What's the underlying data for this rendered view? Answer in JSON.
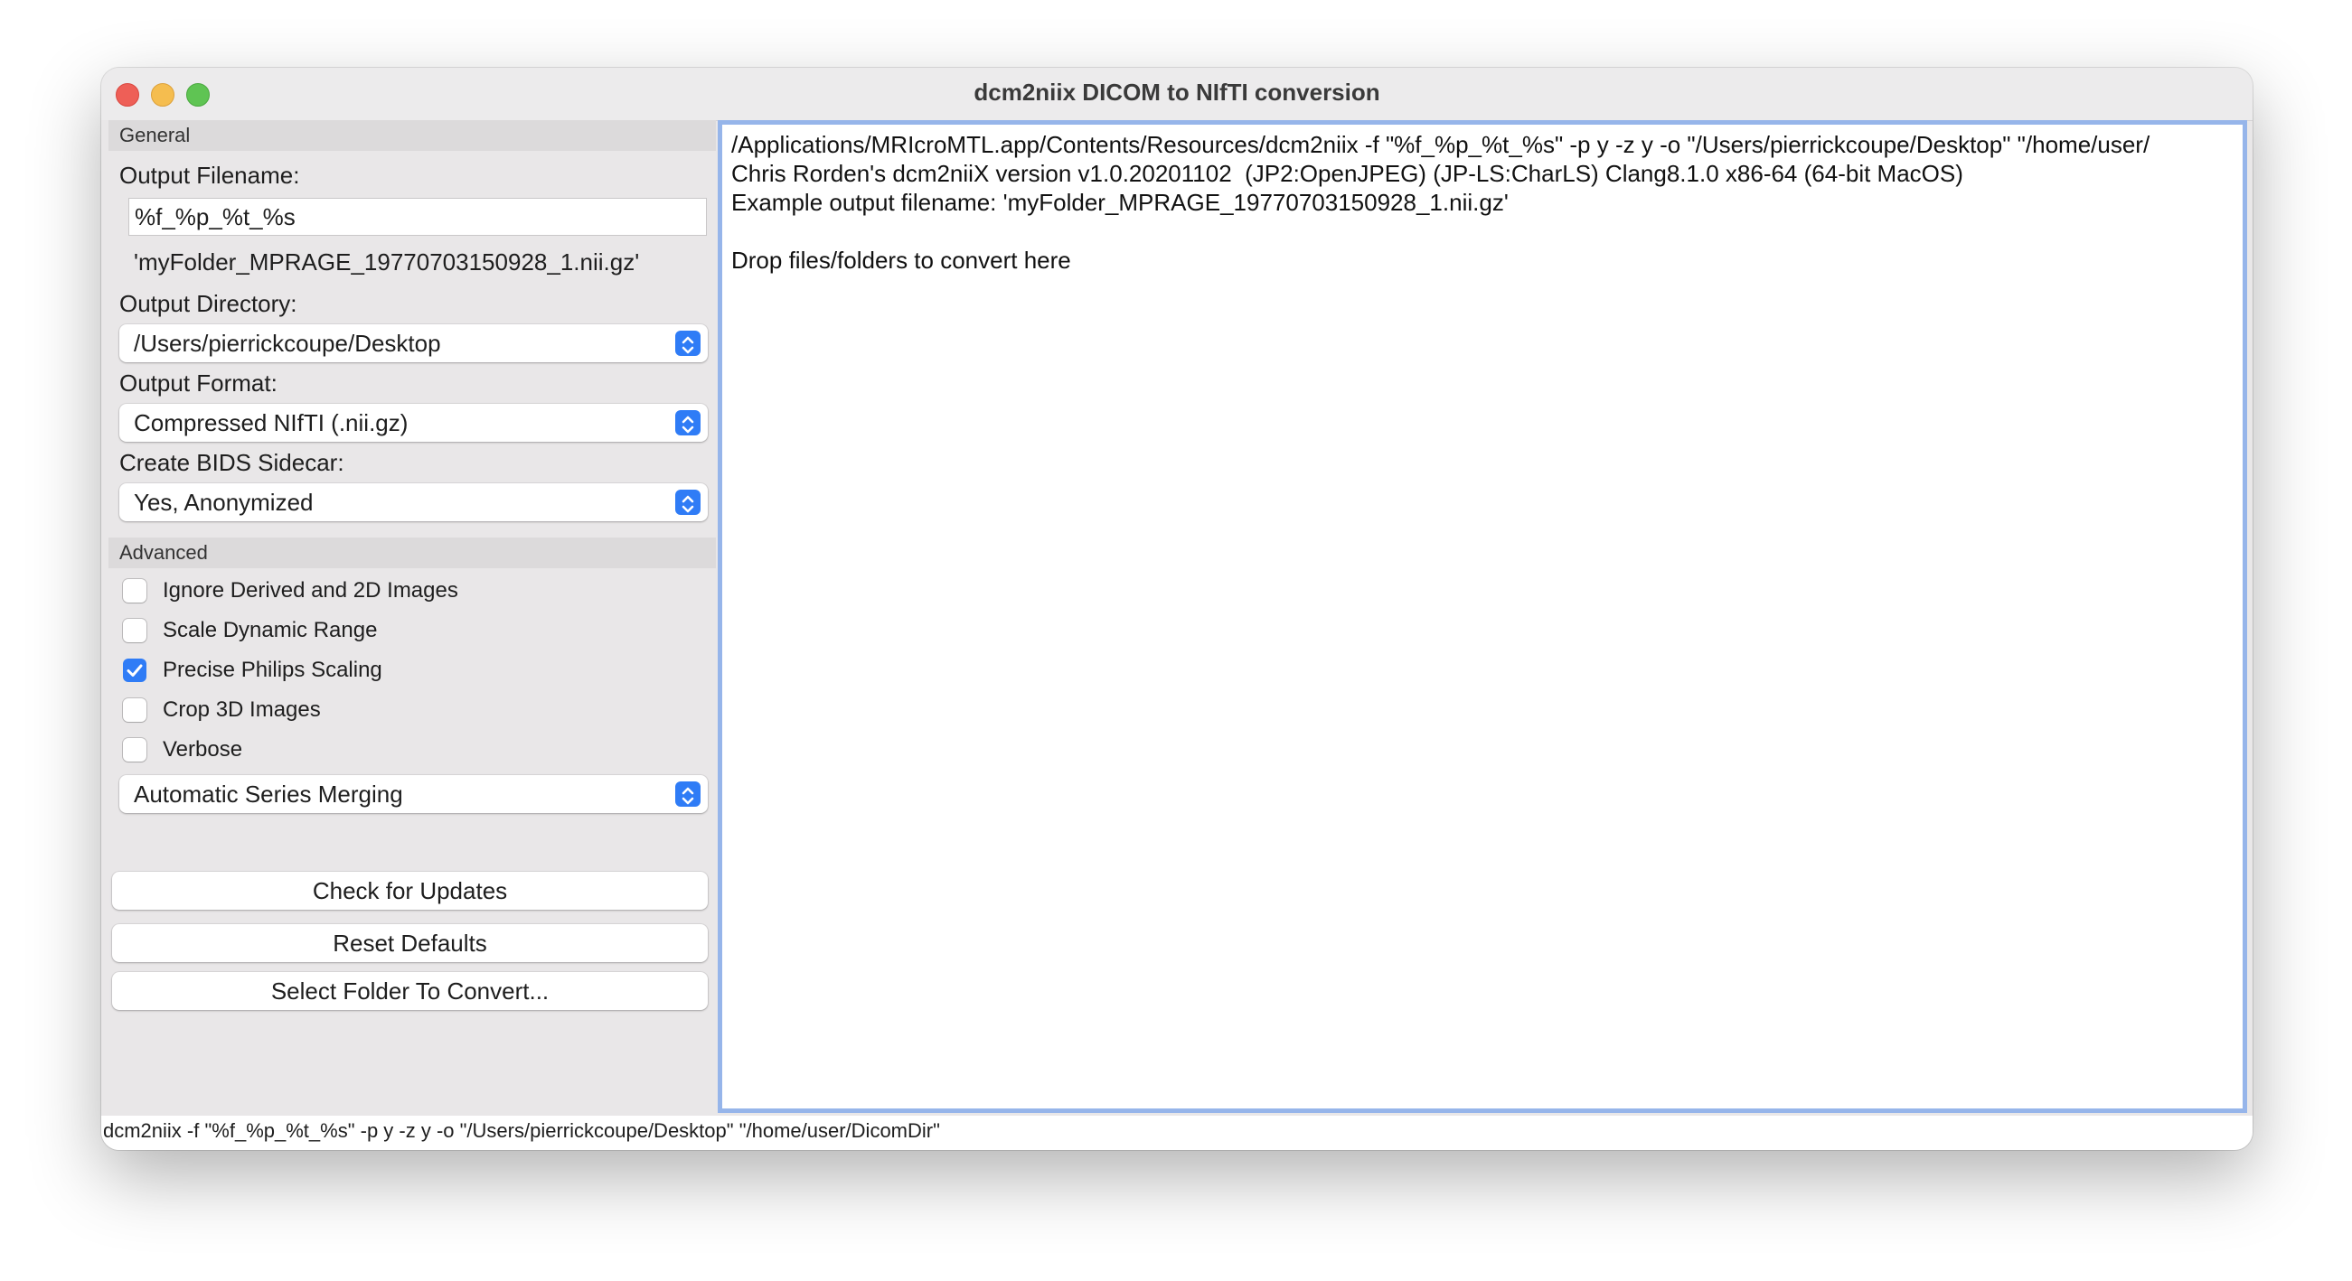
{
  "window": {
    "title": "dcm2niix DICOM to NIfTI conversion"
  },
  "general": {
    "header": "General",
    "output_filename_label": "Output Filename:",
    "output_filename_value": "%f_%p_%t_%s",
    "filename_example": "'myFolder_MPRAGE_19770703150928_1.nii.gz'",
    "output_directory_label": "Output Directory:",
    "output_directory_value": "/Users/pierrickcoupe/Desktop",
    "output_format_label": "Output Format:",
    "output_format_value": "Compressed NIfTI (.nii.gz)",
    "bids_label": "Create BIDS Sidecar:",
    "bids_value": "Yes, Anonymized"
  },
  "advanced": {
    "header": "Advanced",
    "options": [
      {
        "label": "Ignore Derived and 2D Images",
        "checked": false
      },
      {
        "label": "Scale Dynamic Range",
        "checked": false
      },
      {
        "label": "Precise Philips Scaling",
        "checked": true
      },
      {
        "label": "Crop 3D Images",
        "checked": false
      },
      {
        "label": "Verbose",
        "checked": false
      }
    ],
    "merge_value": "Automatic Series Merging"
  },
  "buttons": {
    "check_updates": "Check for Updates",
    "reset_defaults": "Reset Defaults",
    "select_folder": "Select Folder To Convert..."
  },
  "output": {
    "line1": "/Applications/MRIcroMTL.app/Contents/Resources/dcm2niix -f \"%f_%p_%t_%s\" -p y -z y -o \"/Users/pierrickcoupe/Desktop\" \"/home/user/",
    "line2": "Chris Rorden's dcm2niiX version v1.0.20201102  (JP2:OpenJPEG) (JP-LS:CharLS) Clang8.1.0 x86-64 (64-bit MacOS)",
    "line3": "Example output filename: 'myFolder_MPRAGE_19770703150928_1.nii.gz'",
    "line4": "",
    "line5": "Drop files/folders to convert here"
  },
  "statusbar": "dcm2niix -f \"%f_%p_%t_%s\" -p y -z y -o \"/Users/pierrickcoupe/Desktop\" \"/home/user/DicomDir\"",
  "colors": {
    "accent": "#2f7cf6",
    "focus_ring": "#96b5ea"
  }
}
